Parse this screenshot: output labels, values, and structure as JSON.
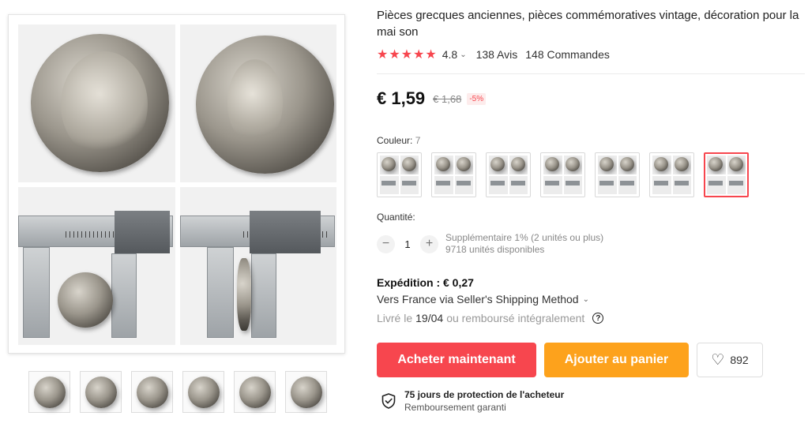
{
  "product": {
    "title": "Pièces grecques anciennes, pièces commémoratives vintage, décoration pour la mai son",
    "rating": {
      "stars": "★★★★★",
      "value": "4.8",
      "reviews": "138 Avis",
      "orders": "148 Commandes"
    },
    "price": {
      "current": "€ 1,59",
      "original": "€ 1,68",
      "discount": "-5%"
    },
    "color": {
      "label": "Couleur:",
      "count": "7",
      "selected_index": 6
    },
    "quantity": {
      "label": "Quantité:",
      "value": "1",
      "minus": "−",
      "plus": "+",
      "extra": "Supplémentaire 1% (2 unités ou plus)",
      "available": "9718 unités disponibles"
    },
    "shipping": {
      "title": "Expédition : € 0,27",
      "method": "Vers France via Seller's Shipping Method",
      "delivery_prefix": "Livré le",
      "delivery_date": "19/04",
      "delivery_suffix": "ou remboursé intégralement",
      "help": "?"
    },
    "actions": {
      "buy_now": "Acheter maintenant",
      "add_to_cart": "Ajouter au panier",
      "wishlist_icon": "♡",
      "wishlist_count": "892"
    },
    "protection": {
      "title": "75 jours de protection de l'acheteur",
      "subtitle": "Remboursement garanti"
    }
  },
  "colors": {
    "accent_red": "#f7464e",
    "accent_orange": "#fda21c"
  },
  "icons": [
    "star-icon",
    "chevron-down-icon",
    "heart-icon",
    "shield-check-icon",
    "help-circle-icon"
  ]
}
